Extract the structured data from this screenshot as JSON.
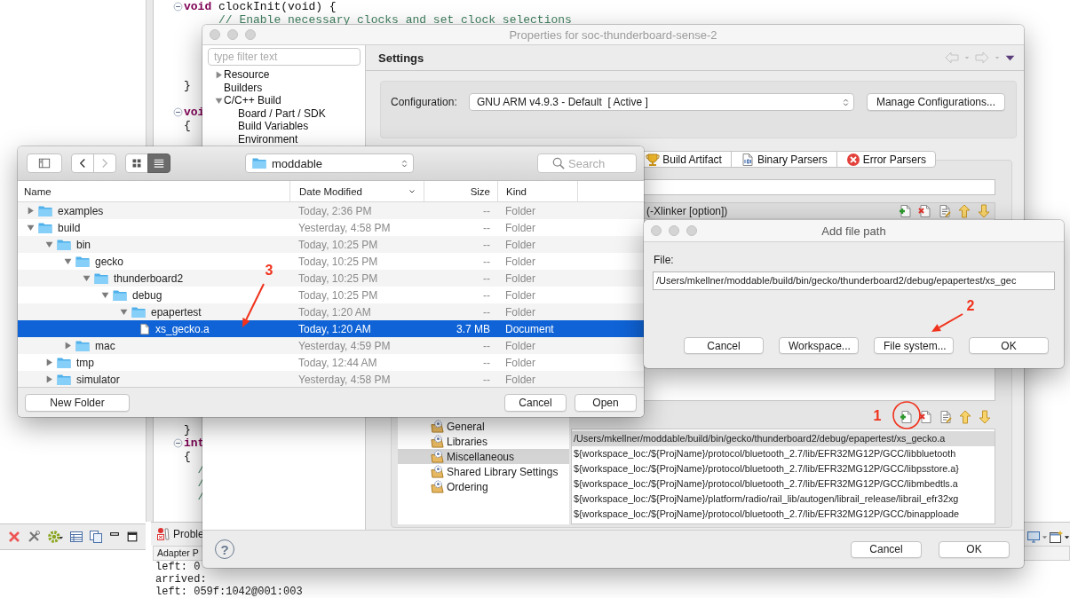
{
  "editor": {
    "blocks": [
      [
        {
          "kind": "code",
          "fold": true,
          "keyword": "void",
          "text": " clockInit(void) {"
        },
        {
          "kind": "comment",
          "text": "     // Enable necessary clocks and set clock selections"
        }
      ],
      [
        {
          "kind": "code",
          "text": "}"
        }
      ],
      [
        {
          "kind": "code",
          "fold": true,
          "keyword": "voi"
        },
        {
          "kind": "code",
          "text": "{"
        }
      ],
      [
        {
          "kind": "code",
          "text": "}"
        },
        {
          "kind": "code",
          "fold": true,
          "keyword": "int"
        },
        {
          "kind": "code",
          "text": "{"
        },
        {
          "kind": "comment",
          "text": "  /"
        },
        {
          "kind": "comment",
          "text": "  /"
        },
        {
          "kind": "comment",
          "text": "  /"
        }
      ]
    ]
  },
  "console": {
    "tab": "Proble",
    "header": "Adapter P",
    "lines": [
      "left: 0",
      "arrived:",
      "left: 059f:1042@001:003"
    ]
  },
  "properties": {
    "title": "Properties for soc-thunderboard-sense-2",
    "filter_placeholder": "type filter text",
    "sidebar": [
      {
        "label": "Resource",
        "expanded": false
      },
      {
        "label": "Builders"
      },
      {
        "label": "C/C++ Build",
        "expanded": true,
        "children": [
          {
            "label": "Board / Part / SDK"
          },
          {
            "label": "Build Variables"
          },
          {
            "label": "Environment"
          }
        ]
      }
    ],
    "heading": "Settings",
    "configuration": {
      "label": "Configuration:",
      "value": "GNU ARM v4.9.3 - Default  [ Active ]",
      "button": "Manage Configurations..."
    },
    "tabs": [
      {
        "label": "Build Artifact",
        "kind": "trophy",
        "selected": false
      },
      {
        "label": "Binary Parsers",
        "kind": "binary",
        "selected": false
      },
      {
        "label": "Error Parsers",
        "kind": "error",
        "selected": false
      }
    ],
    "tool_tree": [
      {
        "label": "General",
        "selected": false
      },
      {
        "label": "Libraries",
        "selected": false
      },
      {
        "label": "Miscellaneous",
        "selected": true
      },
      {
        "label": "Shared Library Settings",
        "selected": false
      },
      {
        "label": "Ordering",
        "selected": false
      }
    ],
    "options_list": {
      "header": "(-Xlinker [option])"
    },
    "objects_list": [
      {
        "text": "/Users/mkellner/moddable/build/bin/gecko/thunderboard2/debug/epapertest/xs_gecko.a",
        "selected": true
      },
      {
        "text": "${workspace_loc:/${ProjName}/protocol/bluetooth_2.7/lib/EFR32MG12P/GCC/libbluetooth",
        "selected": false
      },
      {
        "text": "${workspace_loc:/${ProjName}/protocol/bluetooth_2.7/lib/EFR32MG12P/GCC/libpsstore.a}",
        "selected": false
      },
      {
        "text": "${workspace_loc:/${ProjName}/protocol/bluetooth_2.7/lib/EFR32MG12P/GCC/libmbedtls.a",
        "selected": false
      },
      {
        "text": "${workspace_loc:/${ProjName}/platform/radio/rail_lib/autogen/librail_release/librail_efr32xg",
        "selected": false
      },
      {
        "text": "${workspace_loc:/${ProjName}/protocol/bluetooth_2.7/lib/EFR32MG12P/GCC/binapploade",
        "selected": false
      }
    ],
    "help": "?",
    "buttons": [
      "Cancel",
      "OK"
    ]
  },
  "file_dialog": {
    "views": [
      {
        "kind": "icons",
        "selected": false
      },
      {
        "kind": "list",
        "selected": true
      }
    ],
    "location": "moddable",
    "search_placeholder": "Search",
    "columns": [
      "Name",
      "Date Modified",
      "Size",
      "Kind"
    ],
    "files": [
      {
        "kind": "folder",
        "name": "examples",
        "modified": "Today, 2:36 PM",
        "file_size": "--",
        "kind_column": "Folder",
        "expanded": false,
        "selected": false
      },
      {
        "kind": "folder",
        "name": "build",
        "modified": "Yesterday, 4:58 PM",
        "file_size": "--",
        "kind_column": "Folder",
        "expanded": true,
        "selected": false,
        "children": [
          {
            "kind": "folder",
            "name": "bin",
            "modified": "Today, 10:25 PM",
            "file_size": "--",
            "kind_column": "Folder",
            "expanded": true,
            "selected": false,
            "children": [
              {
                "kind": "folder",
                "name": "gecko",
                "modified": "Today, 10:25 PM",
                "file_size": "--",
                "kind_column": "Folder",
                "expanded": true,
                "selected": false,
                "children": [
                  {
                    "kind": "folder",
                    "name": "thunderboard2",
                    "modified": "Today, 10:25 PM",
                    "file_size": "--",
                    "kind_column": "Folder",
                    "expanded": true,
                    "selected": false,
                    "children": [
                      {
                        "kind": "folder",
                        "name": "debug",
                        "modified": "Today, 10:25 PM",
                        "file_size": "--",
                        "kind_column": "Folder",
                        "expanded": true,
                        "selected": false,
                        "children": [
                          {
                            "kind": "folder",
                            "name": "epapertest",
                            "modified": "Today, 1:20 AM",
                            "file_size": "--",
                            "kind_column": "Folder",
                            "expanded": true,
                            "selected": false,
                            "children": [
                              {
                                "kind": "document",
                                "name": "xs_gecko.a",
                                "modified": "Today, 1:20 AM",
                                "file_size": "3.7 MB",
                                "kind_column": "Document",
                                "selected": true
                              }
                            ]
                          }
                        ]
                      }
                    ]
                  }
                ]
              },
              {
                "kind": "folder",
                "name": "mac",
                "modified": "Yesterday, 4:59 PM",
                "file_size": "--",
                "kind_column": "Folder",
                "expanded": false,
                "selected": false
              }
            ]
          },
          {
            "kind": "folder",
            "name": "tmp",
            "modified": "Today, 12:44 AM",
            "file_size": "--",
            "kind_column": "Folder",
            "expanded": false,
            "selected": false
          },
          {
            "kind": "folder",
            "name": "simulator",
            "modified": "Yesterday, 4:58 PM",
            "file_size": "--",
            "kind_column": "Folder",
            "expanded": false,
            "selected": false
          }
        ]
      }
    ],
    "buttons": {
      "new_folder": "New Folder",
      "cancel": "Cancel",
      "open": "Open"
    }
  },
  "add_file_path": {
    "title": "Add file path",
    "label": "File:",
    "value": "/Users/mkellner/moddable/build/bin/gecko/thunderboard2/debug/epapertest/xs_gec",
    "buttons": [
      "Cancel",
      "Workspace...",
      "File system...",
      "OK"
    ]
  },
  "annotations": [
    {
      "label": "3",
      "kind": "arrow"
    },
    {
      "label": "2",
      "kind": "arrow"
    },
    {
      "label": "1",
      "kind": "circle"
    }
  ]
}
